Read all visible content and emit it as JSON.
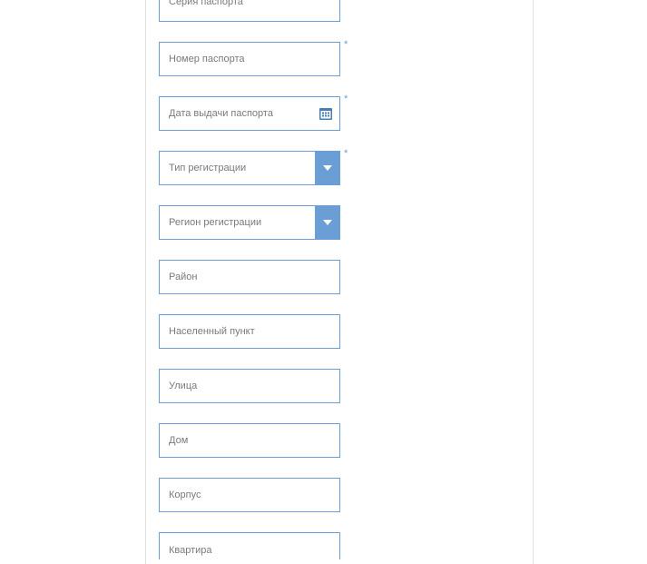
{
  "fields": {
    "passport_series": {
      "placeholder": "Серия паспорта",
      "required": false
    },
    "passport_number": {
      "placeholder": "Номер паспорта",
      "required": true
    },
    "passport_issue_date": {
      "placeholder": "Дата выдачи паспорта",
      "required": true
    },
    "registration_type": {
      "placeholder": "Тип регистрации",
      "required": true
    },
    "registration_region": {
      "placeholder": "Регион регистрации",
      "required": false
    },
    "district": {
      "placeholder": "Район",
      "required": false
    },
    "locality": {
      "placeholder": "Населенный пункт",
      "required": false
    },
    "street": {
      "placeholder": "Улица",
      "required": false
    },
    "house": {
      "placeholder": "Дом",
      "required": false
    },
    "building": {
      "placeholder": "Корпус",
      "required": false
    },
    "apartment": {
      "placeholder": "Квартира",
      "required": false
    }
  },
  "marks": {
    "required": "*"
  },
  "colors": {
    "border": "#6a9ed4",
    "dropdown_bg": "#6a9ed4",
    "placeholder": "#7a7a7a"
  }
}
